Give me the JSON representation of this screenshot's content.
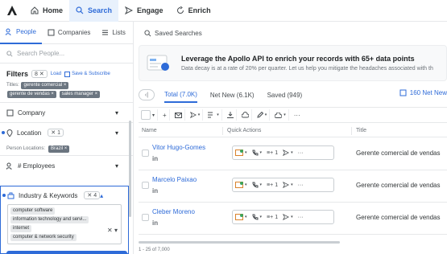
{
  "nav": {
    "tabs": [
      {
        "label": "Home",
        "icon": "home-icon"
      },
      {
        "label": "Search",
        "icon": "search-icon",
        "active": true
      },
      {
        "label": "Engage",
        "icon": "send-icon"
      },
      {
        "label": "Enrich",
        "icon": "refresh-icon"
      }
    ]
  },
  "subnav": {
    "tabs": [
      {
        "label": "People",
        "active": true
      },
      {
        "label": "Companies"
      },
      {
        "label": "Lists"
      },
      {
        "label": "Saved Searches"
      }
    ]
  },
  "sidebar": {
    "search_placeholder": "Search People...",
    "filters_title": "Filters",
    "filters_count": "8",
    "load_label": "Load",
    "save_label": "Save & Subscribe",
    "titles_label": "Titles:",
    "titles": [
      "gerente comercial",
      "gerente de vendas",
      "sales manager"
    ],
    "company_label": "Company",
    "location_label": "Location",
    "location_count": "1",
    "person_locations_label": "Person Locations:",
    "person_location": "Brazil",
    "employees_label": "# Employees",
    "industry_label": "Industry & Keywords",
    "industry_count": "4",
    "industries": [
      "computer software",
      "information technology and servi...",
      "internet",
      "computer & network security"
    ]
  },
  "banner": {
    "title": "Leverage the Apollo API to enrich your records with 65+ data points",
    "subtitle": "Data decay is at a rate of 20% per quarter. Let us help you mitigate the headaches associated with th"
  },
  "results": {
    "tabs": [
      {
        "label": "Total (7.0K)",
        "active": true
      },
      {
        "label": "Net New (6.1K)"
      },
      {
        "label": "Saved (949)"
      }
    ],
    "net_new_button": "160 Net New",
    "columns": {
      "name": "Name",
      "quick": "Quick Actions",
      "title": "Title"
    },
    "rows": [
      {
        "name": "Vitor Hugo-Gomes",
        "title": "Gerente comercial de vendas"
      },
      {
        "name": "Marcelo Paixao",
        "title": "Gerente comercial de vendas"
      },
      {
        "name": "Cleber Moreno",
        "title": "Gerente comercial de vendas"
      }
    ],
    "pager": "1 - 25 of 7,000"
  },
  "colors": {
    "accent": "#2e6bd8",
    "chip": "#6b7580"
  }
}
